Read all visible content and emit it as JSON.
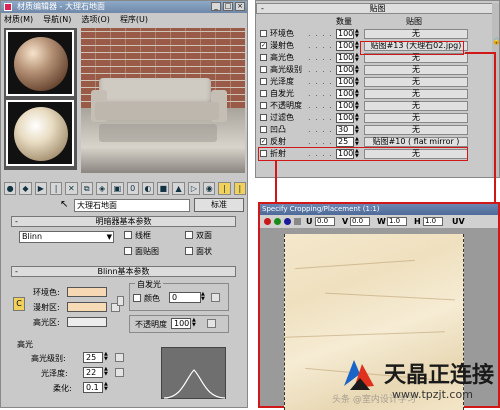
{
  "editor": {
    "title": "材质编辑器 - 大理石地面",
    "menu": [
      "材质(M)",
      "导航(N)",
      "选项(O)",
      "程序(U)"
    ],
    "material_name": "大理石地面",
    "type_button": "标准"
  },
  "shader": {
    "header": "明暗器基本参数",
    "selected": "Blinn",
    "options": {
      "wire": "线框",
      "two_sided": "双面",
      "face_map": "面贴图",
      "faceted": "面状"
    }
  },
  "blinn": {
    "header": "Blinn基本参数",
    "ambient": "环境色:",
    "diffuse": "漫射区:",
    "specular": "高光区:",
    "lock": "C",
    "self_illum_header": "自发光",
    "color_label": "颜色",
    "color_value": "0",
    "opacity_label": "不透明度",
    "opacity_value": "100",
    "highlights_header": "高光",
    "spec_level_label": "高光级别:",
    "spec_level_value": "25",
    "glossiness_label": "光泽度:",
    "glossiness_value": "22",
    "soften_label": "柔化:",
    "soften_value": "0.1"
  },
  "maps": {
    "header": "贴图",
    "col_amount": "数量",
    "col_map": "贴图",
    "rows": [
      {
        "checked": false,
        "label": "环境色",
        "amount": "100",
        "map": "无"
      },
      {
        "checked": true,
        "label": "漫射色",
        "amount": "100",
        "map": "贴图#13 (大理石02.jpg)"
      },
      {
        "checked": false,
        "label": "高光色",
        "amount": "100",
        "map": "无"
      },
      {
        "checked": false,
        "label": "高光级别",
        "amount": "100",
        "map": "无"
      },
      {
        "checked": false,
        "label": "光泽度",
        "amount": "100",
        "map": "无"
      },
      {
        "checked": false,
        "label": "自发光",
        "amount": "100",
        "map": "无"
      },
      {
        "checked": false,
        "label": "不透明度",
        "amount": "100",
        "map": "无"
      },
      {
        "checked": false,
        "label": "过滤色",
        "amount": "100",
        "map": "无"
      },
      {
        "checked": false,
        "label": "凹凸",
        "amount": "30",
        "map": "无"
      },
      {
        "checked": true,
        "label": "反射",
        "amount": "25",
        "map": "贴图#10 ( flat mirror )"
      },
      {
        "checked": false,
        "label": "折射",
        "amount": "100",
        "map": "无"
      }
    ]
  },
  "crop": {
    "title": "Specify Cropping/Placement (1:1)",
    "u_label": "U",
    "u_value": "0.0",
    "v_label": "V",
    "v_value": "0.0",
    "w_label": "W",
    "w_value": "1.0",
    "h_label": "H",
    "h_value": "1.0",
    "uv_label": "UV",
    "dot_colors": [
      "#c81818",
      "#1a8a1a",
      "#1a1a9a",
      "#888888"
    ]
  },
  "watermark": {
    "title": "天晶正连接",
    "url": "www.tpzjt.com",
    "faint": "头条 @室内设计学习"
  }
}
